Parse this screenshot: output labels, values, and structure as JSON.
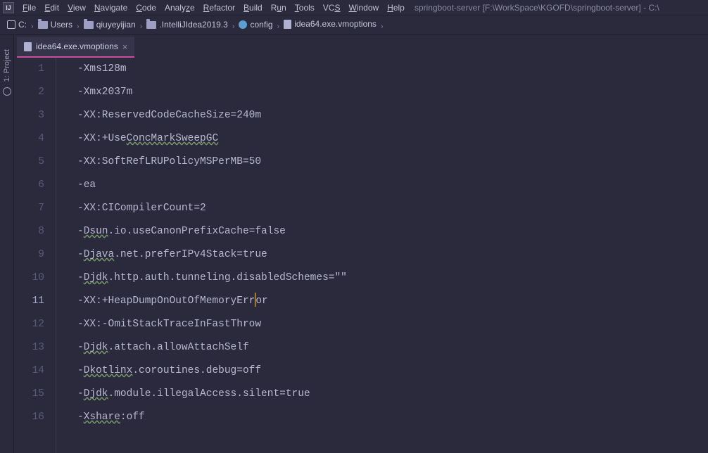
{
  "menubar": {
    "items": [
      {
        "u": "F",
        "rest": "ile"
      },
      {
        "u": "E",
        "rest": "dit"
      },
      {
        "u": "V",
        "rest": "iew"
      },
      {
        "u": "N",
        "rest": "avigate"
      },
      {
        "u": "C",
        "rest": "ode"
      },
      {
        "u": "",
        "rest": "Analy",
        "u2": "z",
        "rest2": "e"
      },
      {
        "u": "R",
        "rest": "efactor"
      },
      {
        "u": "B",
        "rest": "uild"
      },
      {
        "u": "",
        "rest": "R",
        "u2": "u",
        "rest2": "n"
      },
      {
        "u": "T",
        "rest": "ools"
      },
      {
        "u": "",
        "rest": "VC",
        "u2": "S",
        "rest2": ""
      },
      {
        "u": "W",
        "rest": "indow"
      },
      {
        "u": "H",
        "rest": "elp"
      }
    ],
    "title": "springboot-server [F:\\WorkSpace\\KGOFD\\springboot-server] - C:\\"
  },
  "breadcrumbs": [
    {
      "icon": "disk",
      "label": "C:"
    },
    {
      "icon": "folder",
      "label": "Users"
    },
    {
      "icon": "folder",
      "label": "qiuyeyijian"
    },
    {
      "icon": "folder",
      "label": ".IntelliJIdea2019.3"
    },
    {
      "icon": "gear",
      "label": "config"
    },
    {
      "icon": "file",
      "label": "idea64.exe.vmoptions"
    }
  ],
  "toolwindows": {
    "project": "1: Project"
  },
  "tab": {
    "label": "idea64.exe.vmoptions"
  },
  "editor": {
    "current_line": 11,
    "lines": [
      {
        "t": "-Xms128m",
        "typo": []
      },
      {
        "t": "-Xmx2037m",
        "typo": []
      },
      {
        "t": "-XX:ReservedCodeCacheSize=240m",
        "typo": []
      },
      {
        "t": "-XX:+UseConcMarkSweepGC",
        "typo": [
          [
            8,
            "ConcMarkSweepGC"
          ]
        ]
      },
      {
        "t": "-XX:SoftRefLRUPolicyMSPerMB=50",
        "typo": []
      },
      {
        "t": "-ea",
        "typo": []
      },
      {
        "t": "-XX:CICompilerCount=2",
        "typo": []
      },
      {
        "t": "-Dsun.io.useCanonPrefixCache=false",
        "typo": [
          [
            1,
            "Dsun"
          ]
        ]
      },
      {
        "t": "-Djava.net.preferIPv4Stack=true",
        "typo": [
          [
            1,
            "Djava"
          ]
        ]
      },
      {
        "t": "-Djdk.http.auth.tunneling.disabledSchemes=\"\"",
        "typo": [
          [
            1,
            "Djdk"
          ]
        ]
      },
      {
        "t": "-XX:+HeapDumpOnOutOfMemoryError",
        "typo": [],
        "caret": 29
      },
      {
        "t": "-XX:-OmitStackTraceInFastThrow",
        "typo": []
      },
      {
        "t": "-Djdk.attach.allowAttachSelf",
        "typo": [
          [
            1,
            "Djdk"
          ]
        ]
      },
      {
        "t": "-Dkotlinx.coroutines.debug=off",
        "typo": [
          [
            1,
            "Dkotlinx"
          ]
        ]
      },
      {
        "t": "-Djdk.module.illegalAccess.silent=true",
        "typo": [
          [
            1,
            "Djdk"
          ]
        ]
      },
      {
        "t": "-Xshare:off",
        "typo": [
          [
            1,
            "Xshare"
          ]
        ]
      }
    ]
  }
}
